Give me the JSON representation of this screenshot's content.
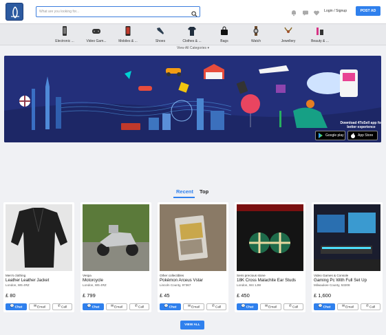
{
  "header": {
    "search_placeholder": "What are you looking for...",
    "login_label": "Login / Signup",
    "post_ad_label": "POST AD"
  },
  "categories": [
    {
      "label": "Electronic ...",
      "icon": "phone-icon"
    },
    {
      "label": "Video Gam...",
      "icon": "gamepad-icon"
    },
    {
      "label": "Mobiles & ...",
      "icon": "mobile-icon"
    },
    {
      "label": "Shoes",
      "icon": "shoe-icon"
    },
    {
      "label": "Clothes & ...",
      "icon": "shirt-icon"
    },
    {
      "label": "Bags",
      "icon": "bag-icon"
    },
    {
      "label": "Watch",
      "icon": "watch-icon"
    },
    {
      "label": "Jewellery",
      "icon": "necklace-icon"
    },
    {
      "label": "Beauty & ...",
      "icon": "cosmetics-icon"
    }
  ],
  "view_all_categories": "View All Categories",
  "banner": {
    "text": "Download 4ToSell app for better experience",
    "google_play": "Google play",
    "app_store": "App Store"
  },
  "tabs": [
    {
      "label": "Recent",
      "active": true
    },
    {
      "label": "Top",
      "active": false
    }
  ],
  "buttons": {
    "chat": "Chat",
    "email": "Email",
    "call": "Call"
  },
  "listings": [
    {
      "category": "Men's clothing",
      "title": "Leather Leather Jacket",
      "location": "London, W5 4RZ",
      "price": "£ 80"
    },
    {
      "category": "Vespa",
      "title": "Motorcycle",
      "location": "London, W5 4RZ",
      "price": "£ 799"
    },
    {
      "category": "Other collectibles",
      "title": "Pokémon Arceus Vstar",
      "location": "Lincoln County, 97367",
      "price": "£ 45"
    },
    {
      "category": "Semi precious stone",
      "title": "18K Cross Malachite Ear Studs",
      "location": "London, W4 1JW",
      "price": "£ 450"
    },
    {
      "category": "Video Games & Console",
      "title": "Gaming Pc With Full Set Up",
      "location": "Milwaukee County, 53208",
      "price": "£ 1,600"
    }
  ],
  "view_all_label": "VIEW ALL",
  "colors": {
    "accent": "#2f80ed",
    "banner_bg": "#232f7a"
  }
}
